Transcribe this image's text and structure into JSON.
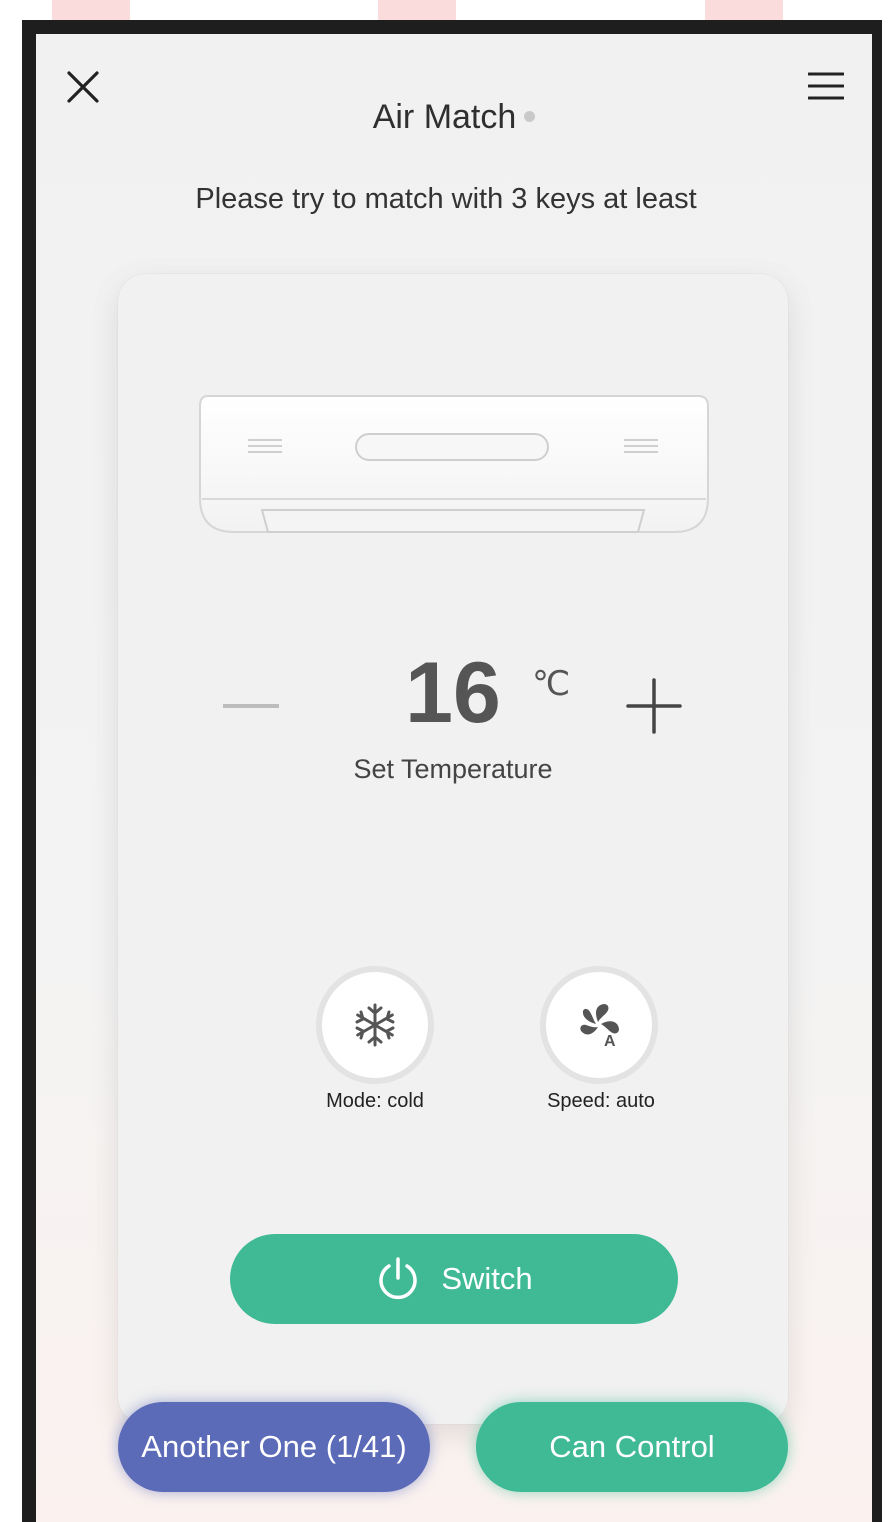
{
  "header": {
    "title": "Air Match",
    "close_icon": "close-icon",
    "menu_icon": "hamburger-menu-icon"
  },
  "instruction": "Please try to match with 3 keys at least",
  "temperature": {
    "value": "16",
    "unit": "℃",
    "label": "Set Temperature"
  },
  "controls": {
    "mode": {
      "label": "Mode: cold",
      "icon": "snowflake-icon"
    },
    "speed": {
      "label": "Speed: auto",
      "icon": "fan-auto-icon"
    }
  },
  "switch": {
    "label": "Switch",
    "icon": "power-icon"
  },
  "footer": {
    "another_label": "Another One (1/41)",
    "can_control_label": "Can Control"
  },
  "colors": {
    "green": "#3fba95",
    "blue": "#5c6bb8"
  }
}
